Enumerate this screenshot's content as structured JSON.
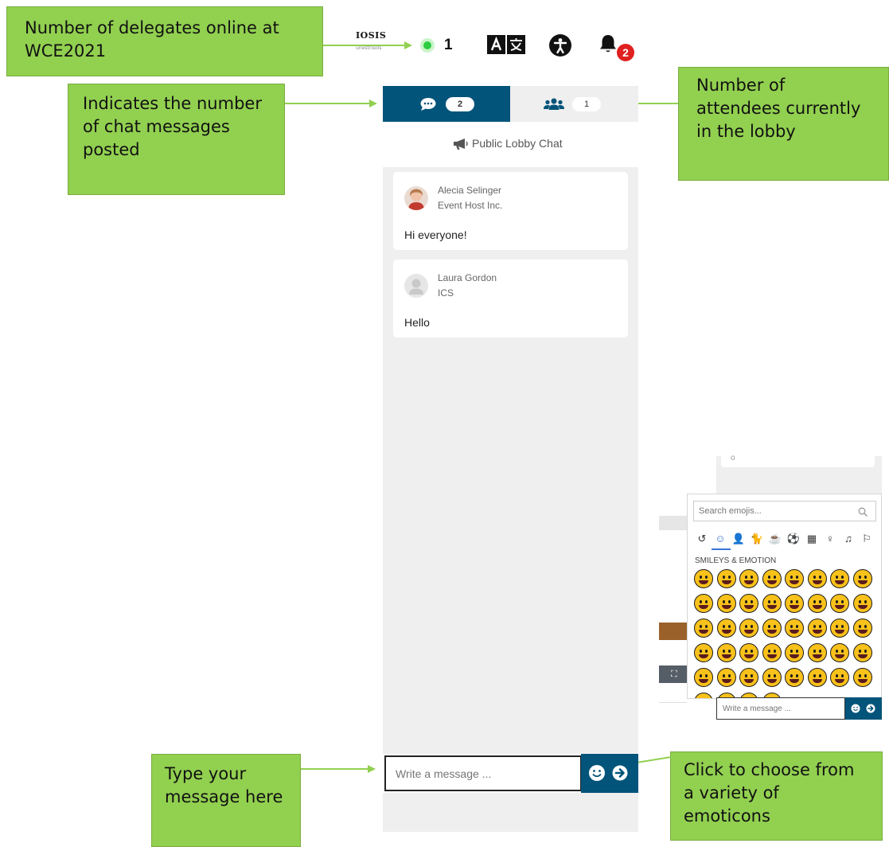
{
  "callouts": {
    "online": "Number of delegates online at WCE2021",
    "chat_count": "Indicates the number of chat messages posted",
    "lobby_count": "Number of attendees currently in the lobby",
    "type_message": "Type your message here",
    "emoticons": "Click to choose from a variety of emoticons"
  },
  "topbar": {
    "logo_text": "IOSIS",
    "logo_subtext": "unestrisols",
    "online_count": "1",
    "notification_count": "2"
  },
  "tabs": {
    "chat_count": "2",
    "lobby_count": "1"
  },
  "lobby": {
    "title": "Public Lobby Chat"
  },
  "messages": [
    {
      "name": "Alecia Selinger",
      "company": "Event Host Inc.",
      "text": "Hi everyone!"
    },
    {
      "name": "Laura Gordon",
      "company": "ICS",
      "text": "Hello"
    }
  ],
  "input": {
    "placeholder": "Write a message ..."
  },
  "emoji_picker": {
    "search_placeholder": "Search emojis...",
    "category_label": "SMILEYS & EMOTION",
    "categories": [
      "recent-icon",
      "smiley-icon",
      "person-icon",
      "animal-icon",
      "food-icon",
      "activity-icon",
      "building-icon",
      "object-icon",
      "music-icon",
      "flag-icon"
    ],
    "emoji_count": 44
  },
  "inset": {
    "placeholder": "Write a message ..."
  },
  "colors": {
    "accent": "#03547a",
    "callout": "#92d050",
    "online": "#2ecc40",
    "badge": "#e02020"
  }
}
